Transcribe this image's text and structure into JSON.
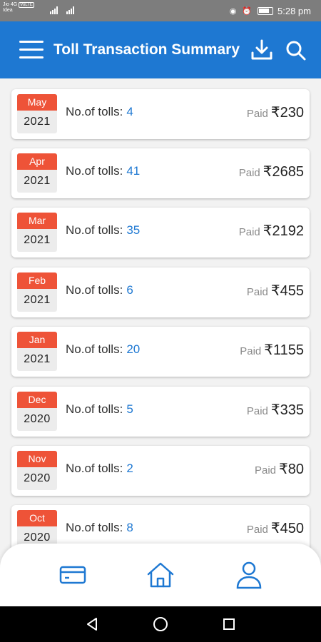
{
  "status_bar": {
    "carrier_1": "Jio 4G",
    "carrier_2": "Idea",
    "network_badge": "VoLTE",
    "icons": [
      "eye-icon",
      "alarm-icon",
      "battery-icon"
    ],
    "battery": "",
    "time": "5:28 pm"
  },
  "app_bar": {
    "title": "Toll Transaction Summary",
    "color": "#1e78d2",
    "icons": [
      "menu-icon",
      "download-icon",
      "search-icon"
    ]
  },
  "labels": {
    "tolls_prefix": "No.of tolls:",
    "paid": "Paid"
  },
  "transactions": [
    {
      "month": "May",
      "year": "2021",
      "tolls": "4",
      "amount": "₹230"
    },
    {
      "month": "Apr",
      "year": "2021",
      "tolls": "41",
      "amount": "₹2685"
    },
    {
      "month": "Mar",
      "year": "2021",
      "tolls": "35",
      "amount": "₹2192"
    },
    {
      "month": "Feb",
      "year": "2021",
      "tolls": "6",
      "amount": "₹455"
    },
    {
      "month": "Jan",
      "year": "2021",
      "tolls": "20",
      "amount": "₹1155"
    },
    {
      "month": "Dec",
      "year": "2020",
      "tolls": "5",
      "amount": "₹335"
    },
    {
      "month": "Nov",
      "year": "2020",
      "tolls": "2",
      "amount": "₹80"
    },
    {
      "month": "Oct",
      "year": "2020",
      "tolls": "8",
      "amount": "₹450"
    }
  ],
  "colors": {
    "badge_month": "#ee5338",
    "toll_count": "#1e78d2",
    "icon_blue": "#1e78d2"
  },
  "bottom_nav": [
    {
      "name": "card-icon"
    },
    {
      "name": "home-icon"
    },
    {
      "name": "profile-icon"
    }
  ],
  "system_nav": [
    "back-icon",
    "home-circle-icon",
    "recents-icon"
  ]
}
